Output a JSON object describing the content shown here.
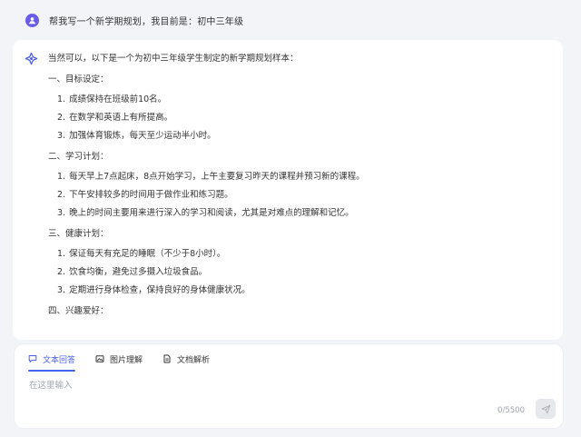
{
  "user_message": {
    "text": "帮我写一个新学期规划，我目前是：初中三年级"
  },
  "answer": {
    "intro": "当然可以，以下是一个为初中三年级学生制定的新学期规划样本：",
    "sections": [
      {
        "title": "一、目标设定：",
        "items": [
          {
            "num": "1.",
            "text": "成绩保持在班级前10名。"
          },
          {
            "num": "2.",
            "text": "在数学和英语上有所提高。"
          },
          {
            "num": "3.",
            "text": "加强体育锻炼，每天至少运动半小时。"
          }
        ]
      },
      {
        "title": "二、学习计划：",
        "items": [
          {
            "num": "1.",
            "text": "每天早上7点起床，8点开始学习，上午主要复习昨天的课程并预习新的课程。"
          },
          {
            "num": "2.",
            "text": "下午安排较多的时间用于做作业和练习题。"
          },
          {
            "num": "3.",
            "text": "晚上的时间主要用来进行深入的学习和阅读，尤其是对难点的理解和记忆。"
          }
        ]
      },
      {
        "title": "三、健康计划：",
        "items": [
          {
            "num": "1.",
            "text": "保证每天有充足的睡眠（不少于8小时）。"
          },
          {
            "num": "2.",
            "text": "饮食均衡，避免过多摄入垃圾食品。"
          },
          {
            "num": "3.",
            "text": "定期进行身体检查，保持良好的身体健康状况。"
          }
        ]
      },
      {
        "title": "四、兴趣爱好：",
        "items": []
      }
    ]
  },
  "input_panel": {
    "tabs": [
      {
        "label": "文本回答",
        "icon": "chat-icon",
        "active": true
      },
      {
        "label": "图片理解",
        "icon": "image-icon",
        "active": false
      },
      {
        "label": "文档解析",
        "icon": "document-icon",
        "active": false
      }
    ],
    "placeholder": "在这里输入",
    "value": "",
    "counter": "0/5500",
    "send_icon": "send-icon"
  },
  "colors": {
    "accent": "#4c5fe8",
    "avatar": "#6b5ce7",
    "background": "#f3f4f8"
  }
}
